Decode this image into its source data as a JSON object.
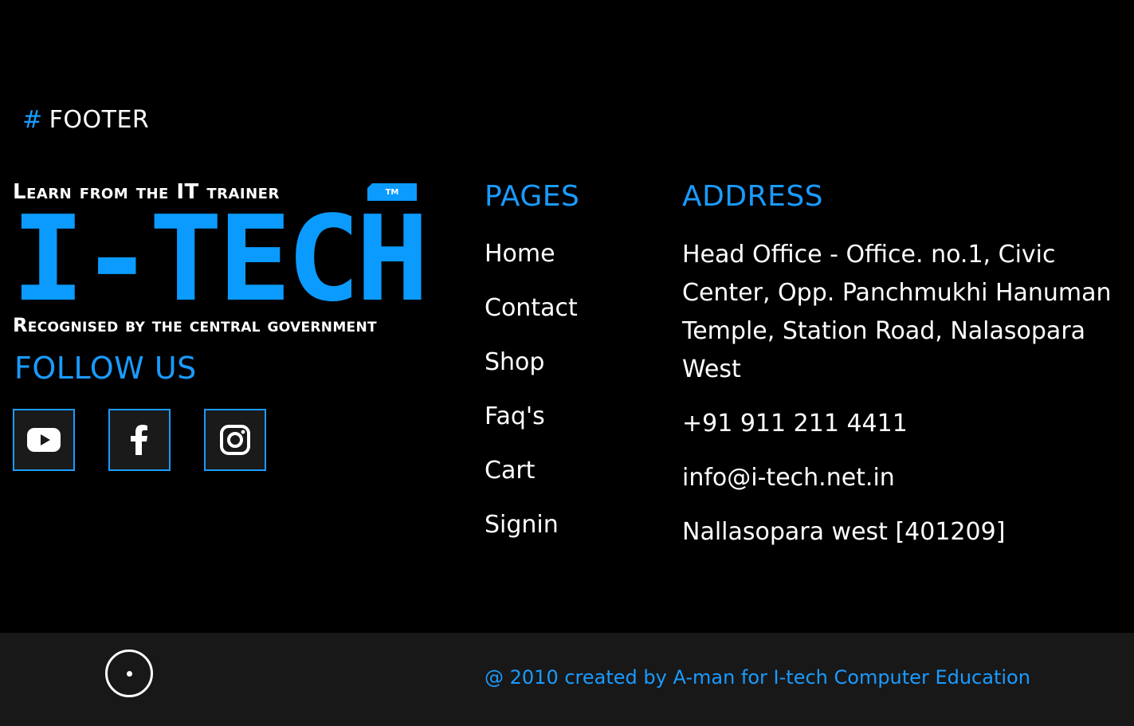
{
  "section": {
    "hash": "#",
    "label": "FOOTER"
  },
  "logo": {
    "tagline_top": "Learn from the IT trainer",
    "tm": "TM",
    "wordmark": "I-TECH",
    "tagline_bottom": "Recognised by the central government"
  },
  "follow": {
    "title": "FOLLOW US",
    "icons": [
      "youtube-icon",
      "facebook-icon",
      "instagram-icon"
    ]
  },
  "pages": {
    "title": "PAGES",
    "links": [
      "Home",
      "Contact",
      "Shop",
      "Faq's",
      "Cart",
      "Signin"
    ]
  },
  "address": {
    "title": "ADDRESS",
    "office": "Head Office - Office. no.1, Civic Center, Opp. Panchmukhi Hanuman Temple, Station Road, Nalasopara West",
    "phone": "+91 911 211 4411",
    "email": "info@i-tech.net.in",
    "area": "Nallasopara west [401209]"
  },
  "copyright": "@ 2010 created by A-man for I-tech Computer Education",
  "colors": {
    "accent": "#1a9bff",
    "background": "#000000",
    "bar": "#181818"
  }
}
